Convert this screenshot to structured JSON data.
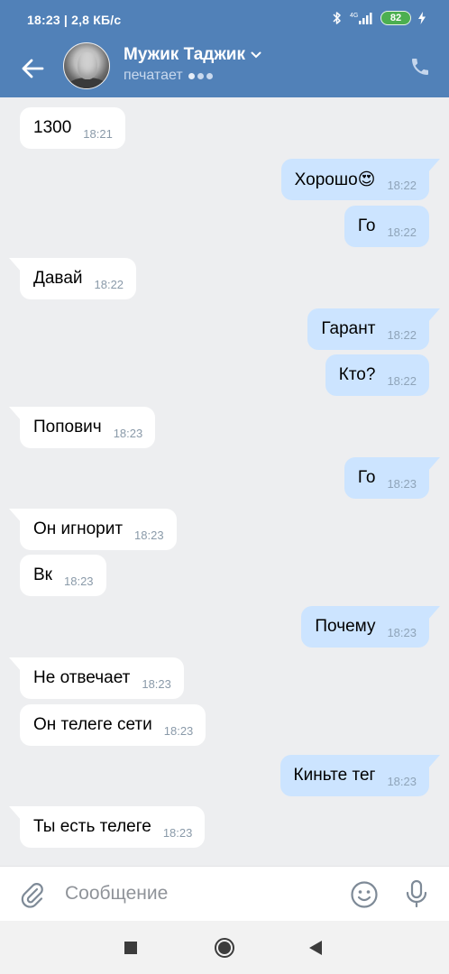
{
  "status_bar": {
    "time_speed": "18:23 | 2,8 КБ/с",
    "network": "4G",
    "battery": "82"
  },
  "chat_header": {
    "contact_name": "Мужик Таджик",
    "status_text": "печатает"
  },
  "messages": [
    {
      "dir": "in",
      "text": "1300",
      "time": "18:21",
      "tail": false
    },
    {
      "dir": "out",
      "text": "Хорошо😍",
      "time": "18:22",
      "tail": true
    },
    {
      "dir": "out",
      "text": "Го",
      "time": "18:22",
      "tail": false
    },
    {
      "dir": "in",
      "text": "Давай",
      "time": "18:22",
      "tail": true
    },
    {
      "dir": "out",
      "text": "Гарант",
      "time": "18:22",
      "tail": true
    },
    {
      "dir": "out",
      "text": "Кто?",
      "time": "18:22",
      "tail": false
    },
    {
      "dir": "in",
      "text": "Попович",
      "time": "18:23",
      "tail": true
    },
    {
      "dir": "out",
      "text": "Го",
      "time": "18:23",
      "tail": true
    },
    {
      "dir": "in",
      "text": "Он игнорит",
      "time": "18:23",
      "tail": true
    },
    {
      "dir": "in",
      "text": "Вк",
      "time": "18:23",
      "tail": false
    },
    {
      "dir": "out",
      "text": "Почему",
      "time": "18:23",
      "tail": true
    },
    {
      "dir": "in",
      "text": "Не отвечает",
      "time": "18:23",
      "tail": true
    },
    {
      "dir": "in",
      "text": "Он телеге  сети",
      "time": "18:23",
      "tail": false
    },
    {
      "dir": "out",
      "text": "Киньте тег",
      "time": "18:23",
      "tail": true
    },
    {
      "dir": "in",
      "text": "Ты есть телеге",
      "time": "18:23",
      "tail": true
    }
  ],
  "composer": {
    "placeholder": "Сообщение",
    "value": ""
  },
  "icons": {
    "back": "arrow-left-icon",
    "call": "phone-icon",
    "attach": "paperclip-icon",
    "emoji": "smiley-icon",
    "mic": "microphone-icon"
  },
  "colors": {
    "header": "#5181b8",
    "chat_background": "#edeef0",
    "incoming_bubble": "#ffffff",
    "outgoing_bubble": "#cce4ff"
  }
}
